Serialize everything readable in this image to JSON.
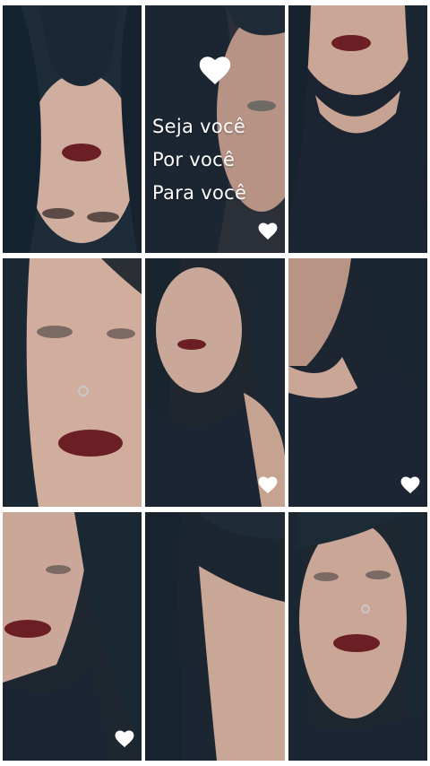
{
  "feed": {
    "tiles": [
      {
        "type": "photo",
        "has_heart": false
      },
      {
        "type": "text-post",
        "has_heart": true,
        "lines": [
          "Seja você",
          "Por você",
          "Para você"
        ],
        "decoration_icon": "heart-icon"
      },
      {
        "type": "photo",
        "has_heart": false
      },
      {
        "type": "photo",
        "has_heart": false
      },
      {
        "type": "photo",
        "has_heart": true
      },
      {
        "type": "photo",
        "has_heart": true
      },
      {
        "type": "photo",
        "has_heart": true
      },
      {
        "type": "photo",
        "has_heart": false
      },
      {
        "type": "photo",
        "has_heart": false
      }
    ]
  },
  "colors": {
    "background": "#ffffff",
    "heart": "#ffffff",
    "hair": "#1c2a36",
    "shirt": "#1b2533",
    "skin": "#d9b7a7",
    "lips": "#6b1f24"
  }
}
